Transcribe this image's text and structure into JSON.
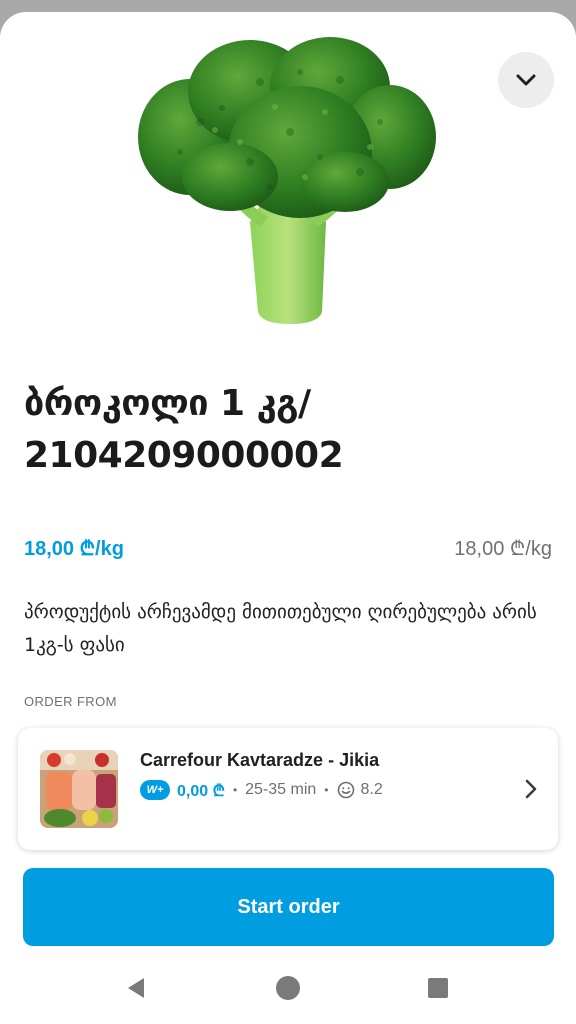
{
  "product": {
    "title": "ბროკოლი 1 კგ/ 2104209000002",
    "price": "18,00 ₾/kg",
    "unit_price": "18,00 ₾/kg",
    "description": "პროდუქტის არჩევამდე მითითებული ღირებულება არის 1კგ-ს ფასი",
    "image_icon": "broccoli-image"
  },
  "order_from": {
    "label": "ORDER FROM",
    "venue_name": "Carrefour Kavtaradze - Jikia",
    "badge": "W+",
    "delivery_fee": "0,00 ₾",
    "delivery_time": "25-35 min",
    "rating": "8.2",
    "dot": "•"
  },
  "actions": {
    "start_order": "Start order"
  },
  "colors": {
    "accent": "#009de0",
    "text": "#202125",
    "muted": "#6e6f72",
    "backdrop": "#a9a9a9"
  },
  "icons": {
    "collapse": "chevron-down-icon",
    "venue_open": "chevron-right-icon",
    "rating": "smiley-icon",
    "nav_back": "back-triangle-icon",
    "nav_home": "home-circle-icon",
    "nav_recents": "recents-square-icon"
  }
}
